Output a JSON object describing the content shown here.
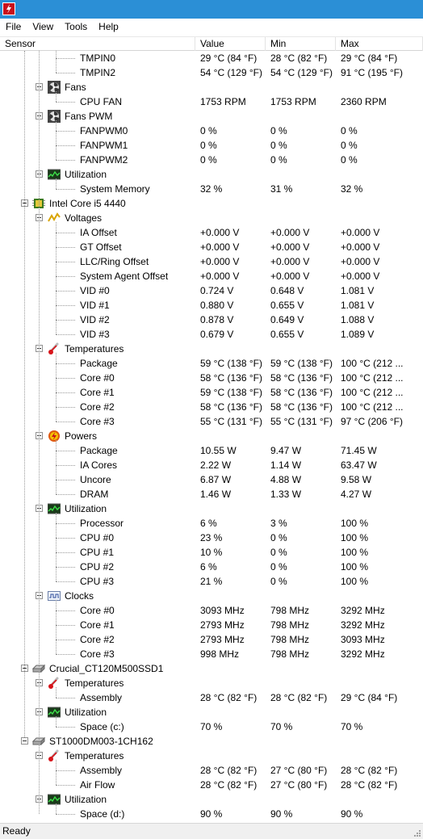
{
  "app": {
    "icon": "app-logo-icon"
  },
  "menu": [
    "File",
    "View",
    "Tools",
    "Help"
  ],
  "columns": [
    "Sensor",
    "Value",
    "Min",
    "Max"
  ],
  "status": "Ready",
  "rows": [
    {
      "level": 3,
      "label": "TMPIN0",
      "value": "29 °C  (84 °F)",
      "min": "28 °C  (82 °F)",
      "max": "29 °C  (84 °F)"
    },
    {
      "level": 3,
      "label": "TMPIN2",
      "value": "54 °C  (129 °F)",
      "min": "54 °C  (129 °F)",
      "max": "91 °C  (195 °F)"
    },
    {
      "level": 2,
      "label": "Fans",
      "icon": "fan-icon",
      "expander": true
    },
    {
      "level": 3,
      "label": "CPU FAN",
      "value": "1753 RPM",
      "min": "1753 RPM",
      "max": "2360 RPM"
    },
    {
      "level": 2,
      "label": "Fans PWM",
      "icon": "fan-icon",
      "expander": true
    },
    {
      "level": 3,
      "label": "FANPWM0",
      "value": "0 %",
      "min": "0 %",
      "max": "0 %"
    },
    {
      "level": 3,
      "label": "FANPWM1",
      "value": "0 %",
      "min": "0 %",
      "max": "0 %"
    },
    {
      "level": 3,
      "label": "FANPWM2",
      "value": "0 %",
      "min": "0 %",
      "max": "0 %"
    },
    {
      "level": 2,
      "label": "Utilization",
      "icon": "utilization-icon",
      "expander": true
    },
    {
      "level": 3,
      "label": "System Memory",
      "value": "32 %",
      "min": "31 %",
      "max": "32 %"
    },
    {
      "level": 1,
      "label": "Intel Core i5 4440",
      "icon": "cpu-chip-icon",
      "expander": true
    },
    {
      "level": 2,
      "label": "Voltages",
      "icon": "voltage-icon",
      "expander": true
    },
    {
      "level": 3,
      "label": "IA Offset",
      "value": "+0.000 V",
      "min": "+0.000 V",
      "max": "+0.000 V"
    },
    {
      "level": 3,
      "label": "GT Offset",
      "value": "+0.000 V",
      "min": "+0.000 V",
      "max": "+0.000 V"
    },
    {
      "level": 3,
      "label": "LLC/Ring Offset",
      "value": "+0.000 V",
      "min": "+0.000 V",
      "max": "+0.000 V"
    },
    {
      "level": 3,
      "label": "System Agent Offset",
      "value": "+0.000 V",
      "min": "+0.000 V",
      "max": "+0.000 V"
    },
    {
      "level": 3,
      "label": "VID #0",
      "value": "0.724 V",
      "min": "0.648 V",
      "max": "1.081 V"
    },
    {
      "level": 3,
      "label": "VID #1",
      "value": "0.880 V",
      "min": "0.655 V",
      "max": "1.081 V"
    },
    {
      "level": 3,
      "label": "VID #2",
      "value": "0.878 V",
      "min": "0.649 V",
      "max": "1.088 V"
    },
    {
      "level": 3,
      "label": "VID #3",
      "value": "0.679 V",
      "min": "0.655 V",
      "max": "1.089 V"
    },
    {
      "level": 2,
      "label": "Temperatures",
      "icon": "thermometer-icon",
      "expander": true
    },
    {
      "level": 3,
      "label": "Package",
      "value": "59 °C  (138 °F)",
      "min": "59 °C  (138 °F)",
      "max": "100 °C  (212 ..."
    },
    {
      "level": 3,
      "label": "Core #0",
      "value": "58 °C  (136 °F)",
      "min": "58 °C  (136 °F)",
      "max": "100 °C  (212 ..."
    },
    {
      "level": 3,
      "label": "Core #1",
      "value": "59 °C  (138 °F)",
      "min": "58 °C  (136 °F)",
      "max": "100 °C  (212 ..."
    },
    {
      "level": 3,
      "label": "Core #2",
      "value": "58 °C  (136 °F)",
      "min": "58 °C  (136 °F)",
      "max": "100 °C  (212 ..."
    },
    {
      "level": 3,
      "label": "Core #3",
      "value": "55 °C  (131 °F)",
      "min": "55 °C  (131 °F)",
      "max": "97 °C  (206 °F)"
    },
    {
      "level": 2,
      "label": "Powers",
      "icon": "power-icon",
      "expander": true
    },
    {
      "level": 3,
      "label": "Package",
      "value": "10.55 W",
      "min": "9.47 W",
      "max": "71.45 W"
    },
    {
      "level": 3,
      "label": "IA Cores",
      "value": "2.22 W",
      "min": "1.14 W",
      "max": "63.47 W"
    },
    {
      "level": 3,
      "label": "Uncore",
      "value": "6.87 W",
      "min": "4.88 W",
      "max": "9.58 W"
    },
    {
      "level": 3,
      "label": "DRAM",
      "value": "1.46 W",
      "min": "1.33 W",
      "max": "4.27 W"
    },
    {
      "level": 2,
      "label": "Utilization",
      "icon": "utilization-icon",
      "expander": true
    },
    {
      "level": 3,
      "label": "Processor",
      "value": "6 %",
      "min": "3 %",
      "max": "100 %"
    },
    {
      "level": 3,
      "label": "CPU #0",
      "value": "23 %",
      "min": "0 %",
      "max": "100 %"
    },
    {
      "level": 3,
      "label": "CPU #1",
      "value": "10 %",
      "min": "0 %",
      "max": "100 %"
    },
    {
      "level": 3,
      "label": "CPU #2",
      "value": "6 %",
      "min": "0 %",
      "max": "100 %"
    },
    {
      "level": 3,
      "label": "CPU #3",
      "value": "21 %",
      "min": "0 %",
      "max": "100 %"
    },
    {
      "level": 2,
      "label": "Clocks",
      "icon": "clock-wave-icon",
      "expander": true
    },
    {
      "level": 3,
      "label": "Core #0",
      "value": "3093 MHz",
      "min": "798 MHz",
      "max": "3292 MHz"
    },
    {
      "level": 3,
      "label": "Core #1",
      "value": "2793 MHz",
      "min": "798 MHz",
      "max": "3292 MHz"
    },
    {
      "level": 3,
      "label": "Core #2",
      "value": "2793 MHz",
      "min": "798 MHz",
      "max": "3093 MHz"
    },
    {
      "level": 3,
      "label": "Core #3",
      "value": "998 MHz",
      "min": "798 MHz",
      "max": "3292 MHz"
    },
    {
      "level": 1,
      "label": "Crucial_CT120M500SSD1",
      "icon": "disk-drive-icon",
      "expander": true
    },
    {
      "level": 2,
      "label": "Temperatures",
      "icon": "thermometer-icon",
      "expander": true
    },
    {
      "level": 3,
      "label": "Assembly",
      "value": "28 °C  (82 °F)",
      "min": "28 °C  (82 °F)",
      "max": "29 °C  (84 °F)"
    },
    {
      "level": 2,
      "label": "Utilization",
      "icon": "utilization-icon",
      "expander": true
    },
    {
      "level": 3,
      "label": "Space (c:)",
      "value": "70 %",
      "min": "70 %",
      "max": "70 %"
    },
    {
      "level": 1,
      "label": "ST1000DM003-1CH162",
      "icon": "disk-drive-icon",
      "expander": true
    },
    {
      "level": 2,
      "label": "Temperatures",
      "icon": "thermometer-icon",
      "expander": true
    },
    {
      "level": 3,
      "label": "Assembly",
      "value": "28 °C  (82 °F)",
      "min": "27 °C  (80 °F)",
      "max": "28 °C  (82 °F)"
    },
    {
      "level": 3,
      "label": "Air Flow",
      "value": "28 °C  (82 °F)",
      "min": "27 °C  (80 °F)",
      "max": "28 °C  (82 °F)"
    },
    {
      "level": 2,
      "label": "Utilization",
      "icon": "utilization-icon",
      "expander": true
    },
    {
      "level": 3,
      "label": "Space (d:)",
      "value": "90 %",
      "min": "90 %",
      "max": "90 %"
    }
  ]
}
